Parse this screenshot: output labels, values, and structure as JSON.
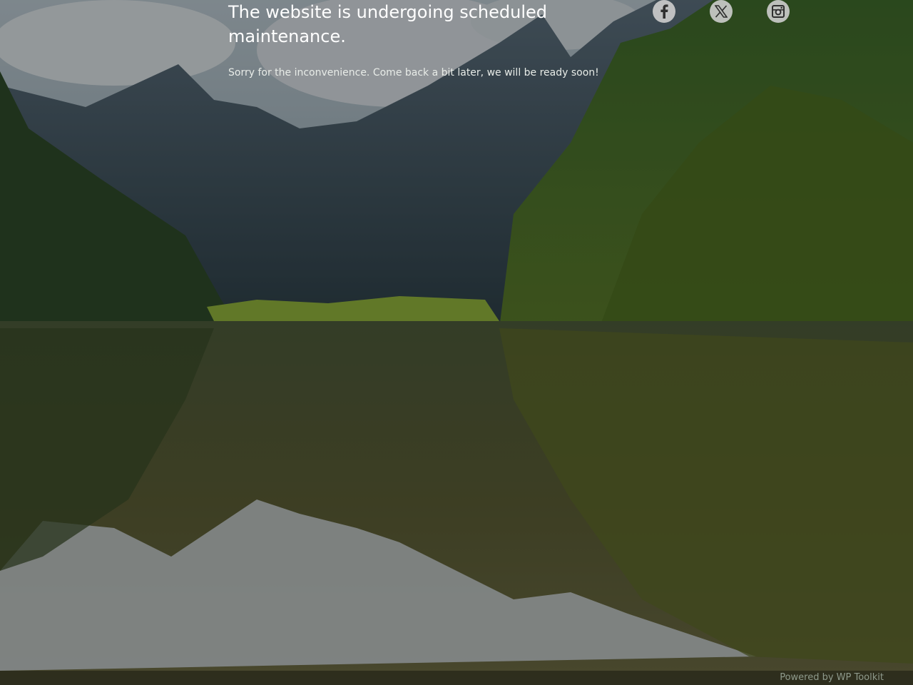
{
  "page": {
    "heading": "The website is undergoing scheduled maintenance.",
    "message": "Sorry for the inconvenience. Come back a bit later, we will be ready soon!"
  },
  "social": [
    {
      "name": "facebook",
      "icon": "facebook-icon"
    },
    {
      "name": "x",
      "icon": "x-twitter-icon"
    },
    {
      "name": "instagram",
      "icon": "instagram-icon"
    }
  ],
  "footer": {
    "prefix": "Powered by ",
    "link_text": "WP Toolkit"
  },
  "background": {
    "description_icon": "mountain-lake-background"
  },
  "colors": {
    "text": "#ffffff",
    "footer_text": "#8f9a8c",
    "social_bg": "#cdcdcd",
    "social_icon": "#2f2f2f"
  }
}
